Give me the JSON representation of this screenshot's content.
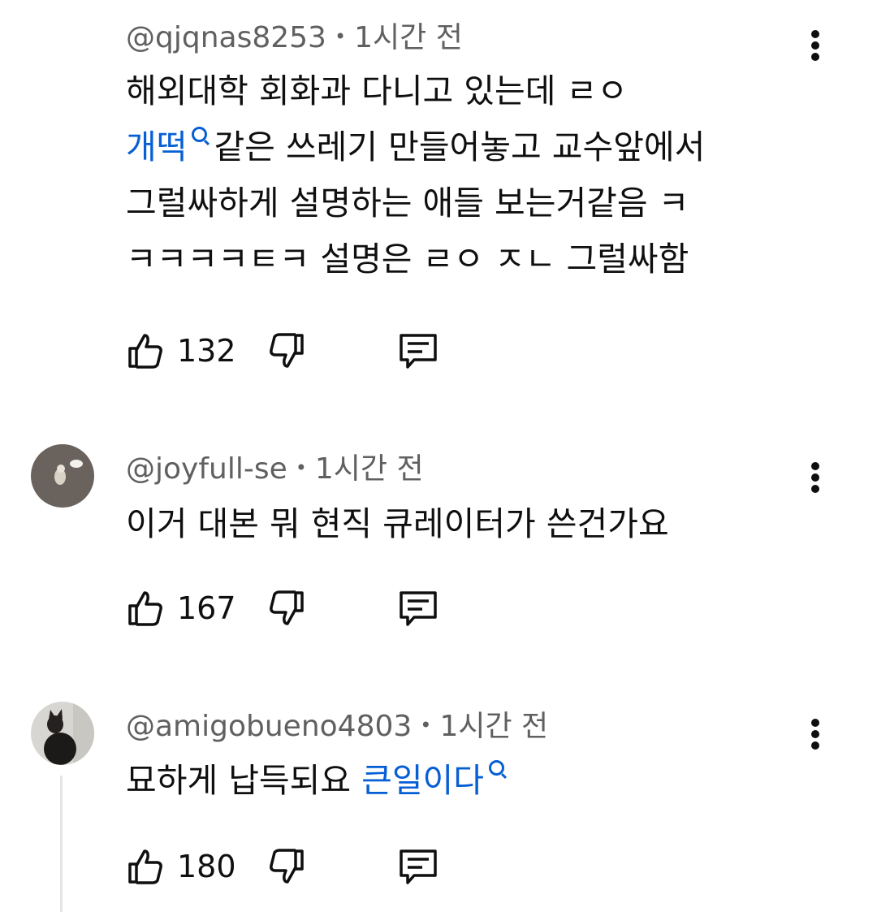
{
  "comments": [
    {
      "handle": "@qjqnas8253",
      "time": "1시간 전",
      "lines": [
        {
          "before": "해외대학 회화과 다니고 있는데 ㄹㅇ"
        },
        {
          "link": "개떡",
          "after": "같은 쓰레기 만들어놓고 교수앞에서"
        },
        {
          "before": "그럴싸하게 설명하는 애들 보는거같음 ㅋ"
        },
        {
          "before": "ㅋㅋㅋㅋㅌㅋ 설명은 ㄹㅇ ㅈㄴ 그럴싸함"
        }
      ],
      "likes": "132"
    },
    {
      "handle": "@joyfull-se",
      "time": "1시간 전",
      "lines": [
        {
          "before": "이거 대본 뭐 현직 큐레이터가 쓴건가요"
        }
      ],
      "likes": "167"
    },
    {
      "handle": "@amigobueno4803",
      "time": "1시간 전",
      "lines": [
        {
          "before": "묘하게 납득되요 ",
          "link": "큰일이다"
        }
      ],
      "likes": "180"
    }
  ],
  "icons": {
    "like": "thumbs-up-icon",
    "dislike": "thumbs-down-icon",
    "reply": "reply-comment-icon",
    "more": "more-vertical-icon"
  },
  "colors": {
    "link": "#065fd4",
    "meta": "#606060",
    "text": "#0f0f0f"
  }
}
